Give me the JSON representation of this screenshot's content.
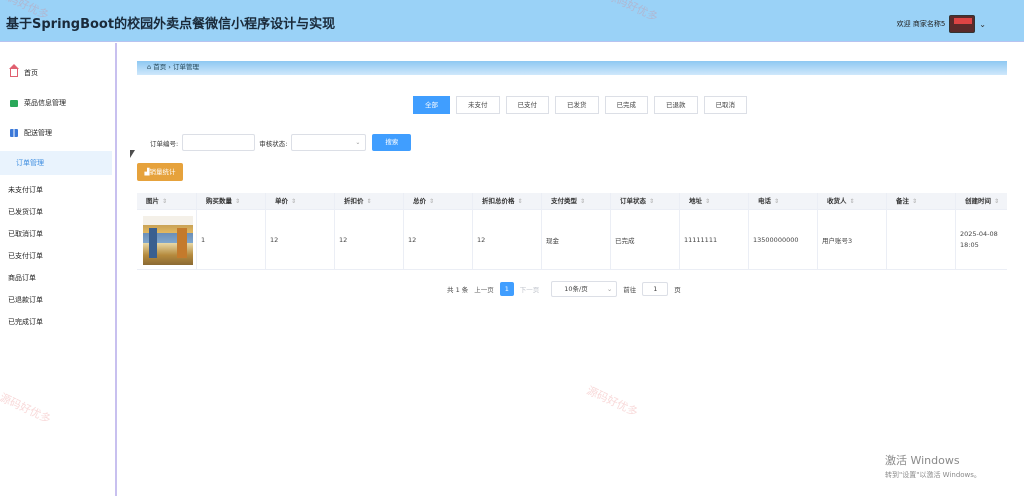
{
  "header": {
    "title": "基于SpringBoot的校园外卖点餐微信小程序设计与实现",
    "welcome": "欢迎 商家名称5"
  },
  "sidebar": {
    "items": [
      {
        "label": "首页",
        "icon": "home-icon"
      },
      {
        "label": "菜品信息管理",
        "icon": "dish-icon"
      },
      {
        "label": "配送管理",
        "icon": "delivery-icon"
      },
      {
        "label": "订单管理",
        "icon": "order-icon"
      }
    ],
    "sub_items": [
      "未支付订单",
      "已发货订单",
      "已取消订单",
      "已支付订单",
      "商品订单",
      "已退款订单",
      "已完成订单"
    ]
  },
  "breadcrumb": {
    "home": "首页",
    "current": "订单管理"
  },
  "tabs": [
    "全部",
    "未支付",
    "已支付",
    "已发货",
    "已完成",
    "已退款",
    "已取消"
  ],
  "filters": {
    "order_no_label": "订单编号:",
    "status_label": "审核状态:",
    "search_label": "搜索"
  },
  "stats_button": "销量统计",
  "table": {
    "columns": [
      "图片",
      "购买数量",
      "单价",
      "折扣价",
      "总价",
      "折扣总价格",
      "支付类型",
      "订单状态",
      "地址",
      "电话",
      "收货人",
      "备注",
      "创建时间"
    ],
    "rows": [
      {
        "quantity": "1",
        "price": "12",
        "discount_price": "12",
        "total": "12",
        "discount_total": "12",
        "pay_type": "现金",
        "status": "已完成",
        "address": "11111111",
        "phone": "13500000000",
        "receiver": "用户账号3",
        "remark": "",
        "created": "2025-04-08 18:05"
      }
    ]
  },
  "pagination": {
    "total": "共 1 条",
    "prev": "上一页",
    "page": "1",
    "next": "下一页",
    "page_size": "10条/页",
    "goto": "前往",
    "goto_value": "1",
    "page_unit": "页"
  },
  "watermark": "源码好优多",
  "windows": {
    "line1": "激活 Windows",
    "line2": "转到\"设置\"以激活 Windows。"
  },
  "colors": {
    "header_bg": "#9ad2f7",
    "primary": "#409eff",
    "warning": "#e6a23c"
  }
}
